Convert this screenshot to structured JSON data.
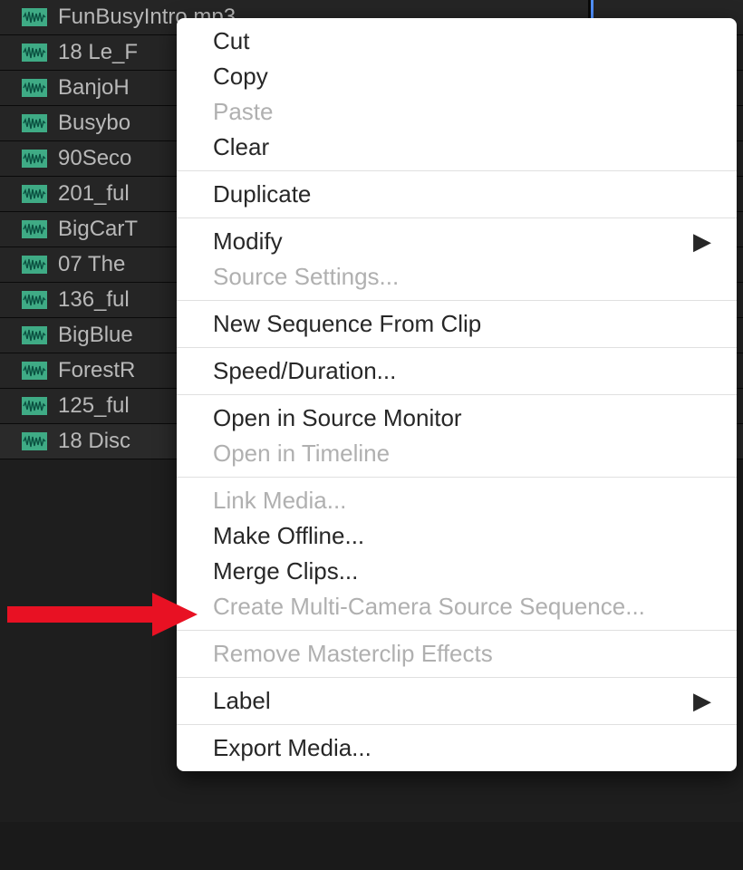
{
  "files": [
    {
      "name": "FunBusyIntro.mp3"
    },
    {
      "name": "18 Le_F"
    },
    {
      "name": "BanjoH"
    },
    {
      "name": "Busybo"
    },
    {
      "name": "90Seco"
    },
    {
      "name": "201_ful"
    },
    {
      "name": "BigCarT"
    },
    {
      "name": "07 The"
    },
    {
      "name": "136_ful"
    },
    {
      "name": "BigBlue"
    },
    {
      "name": "ForestR"
    },
    {
      "name": "125_ful"
    },
    {
      "name": "18 Disc"
    }
  ],
  "contextMenu": {
    "groups": [
      [
        {
          "label": "Cut",
          "enabled": true
        },
        {
          "label": "Copy",
          "enabled": true
        },
        {
          "label": "Paste",
          "enabled": false
        },
        {
          "label": "Clear",
          "enabled": true
        }
      ],
      [
        {
          "label": "Duplicate",
          "enabled": true
        }
      ],
      [
        {
          "label": "Modify",
          "enabled": true,
          "submenu": true
        },
        {
          "label": "Source Settings...",
          "enabled": false
        }
      ],
      [
        {
          "label": "New Sequence From Clip",
          "enabled": true
        }
      ],
      [
        {
          "label": "Speed/Duration...",
          "enabled": true
        }
      ],
      [
        {
          "label": "Open in Source Monitor",
          "enabled": true
        },
        {
          "label": "Open in Timeline",
          "enabled": false
        }
      ],
      [
        {
          "label": "Link Media...",
          "enabled": false
        },
        {
          "label": "Make Offline...",
          "enabled": true
        },
        {
          "label": "Merge Clips...",
          "enabled": true
        },
        {
          "label": "Create Multi-Camera Source Sequence...",
          "enabled": false
        }
      ],
      [
        {
          "label": "Remove Masterclip Effects",
          "enabled": false
        }
      ],
      [
        {
          "label": "Label",
          "enabled": true,
          "submenu": true
        }
      ],
      [
        {
          "label": "Export Media...",
          "enabled": true
        }
      ]
    ]
  },
  "annotationColor": "#e81123"
}
